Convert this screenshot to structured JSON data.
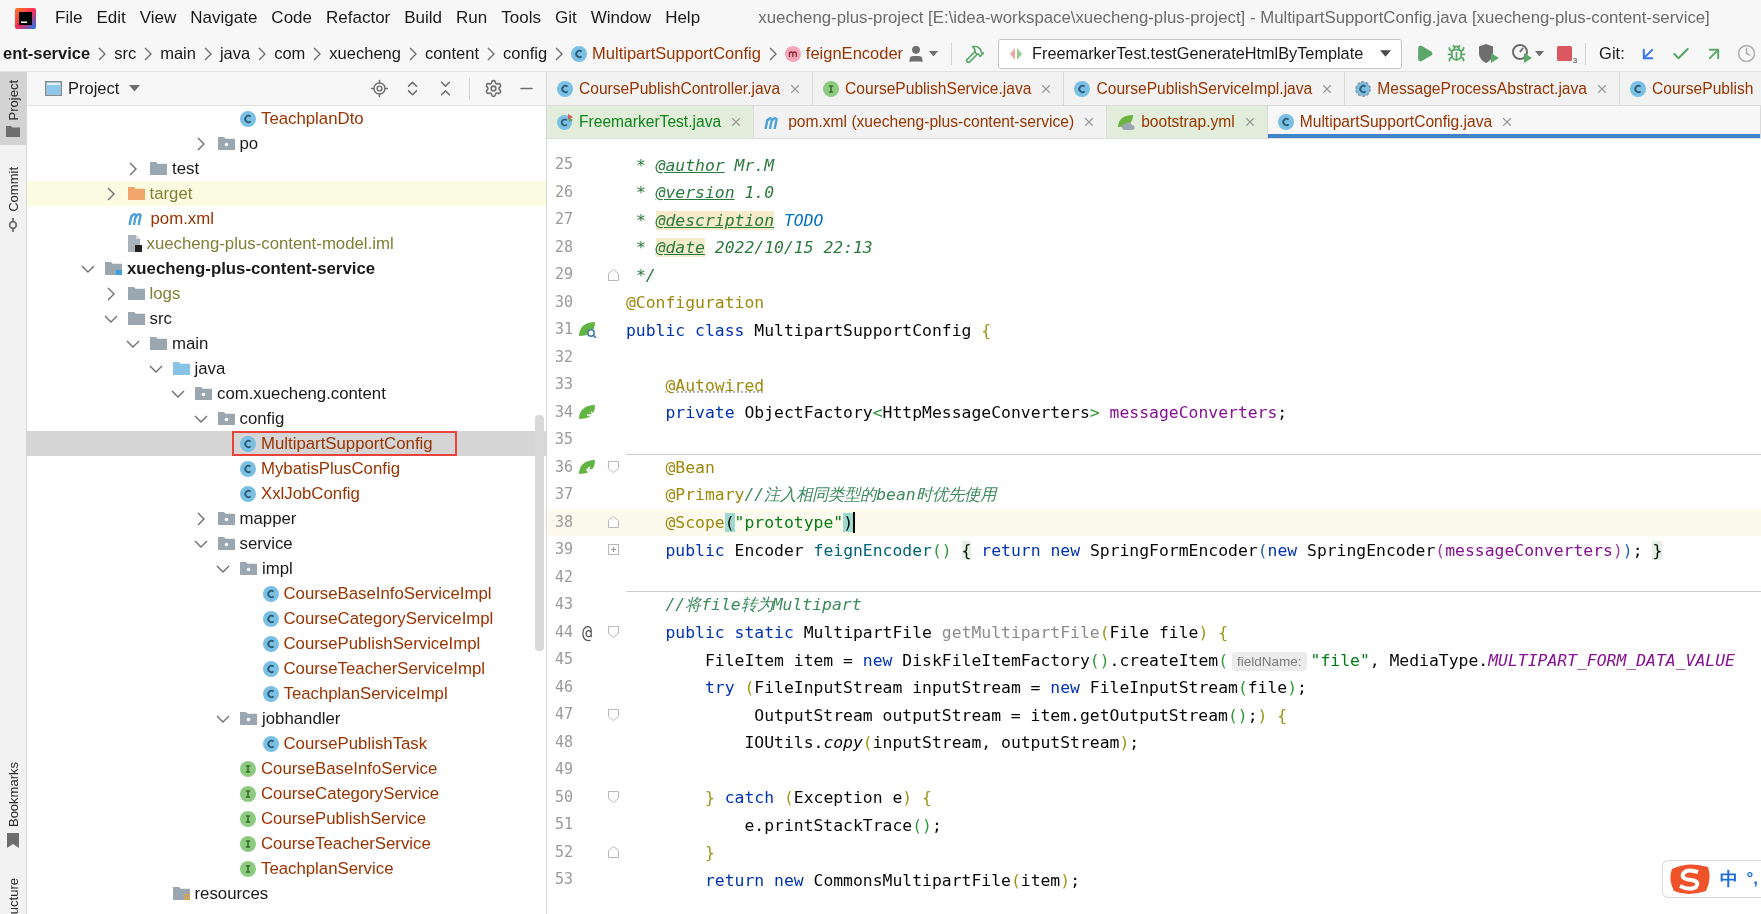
{
  "menu_bar": {
    "items": [
      "File",
      "Edit",
      "View",
      "Navigate",
      "Code",
      "Refactor",
      "Build",
      "Run",
      "Tools",
      "Git",
      "Window",
      "Help"
    ],
    "title": "xuecheng-plus-project [E:\\idea-workspace\\xuecheng-plus-project] - MultipartSupportConfig.java [xuecheng-plus-content-service]"
  },
  "breadcrumbs": [
    {
      "label": "ent-service",
      "kind": "module"
    },
    {
      "label": "src",
      "kind": "folder"
    },
    {
      "label": "main",
      "kind": "folder"
    },
    {
      "label": "java",
      "kind": "folder"
    },
    {
      "label": "com",
      "kind": "folder"
    },
    {
      "label": "xuecheng",
      "kind": "folder"
    },
    {
      "label": "content",
      "kind": "folder"
    },
    {
      "label": "config",
      "kind": "folder"
    },
    {
      "label": "MultipartSupportConfig",
      "kind": "class",
      "color": "#993300"
    },
    {
      "label": "feignEncoder",
      "kind": "method",
      "color": "#993300"
    }
  ],
  "toolbar": {
    "run_configuration": "FreemarkerTest.testGenerateHtmlByTemplate",
    "stop_badge": "3",
    "git_label": "Git:"
  },
  "tool_strip": {
    "top": [
      {
        "label": "Project",
        "kind": "project",
        "selected": true
      },
      {
        "label": "Commit",
        "kind": "commit",
        "selected": false
      }
    ],
    "bottom": [
      {
        "label": "Bookmarks",
        "kind": "bookmarks",
        "selected": false
      },
      {
        "label": "ucture",
        "kind": "structure",
        "selected": false
      }
    ]
  },
  "project_panel": {
    "title": "Project",
    "tree": [
      {
        "children": [
          {
            "children": [
              {
                "children": [
                  {
                    "children": [
                      {
                        "children": [
                          {
                            "children": [
                              {
                                "label": "TeachplanDto",
                                "kind": "class",
                                "color": "#993300",
                                "selected": false
                              }
                            ]
                          },
                          {
                            "label": "po",
                            "kind": "package",
                            "expanded": false,
                            "selected": false
                          }
                        ]
                      }
                    ]
                  }
                ]
              },
              {
                "label": "test",
                "kind": "folder",
                "expanded": false,
                "selected": false
              }
            ]
          },
          {
            "label": "target",
            "kind": "excluded",
            "expanded": false,
            "color": "#7f7f36",
            "selected": false
          },
          {
            "label": "pom.xml",
            "kind": "maven",
            "color": "#993300",
            "selected": false
          },
          {
            "label": "xuecheng-plus-content-model.iml",
            "kind": "iml",
            "color": "#7f7f36",
            "selected": false
          }
        ]
      },
      {
        "label": "xuecheng-plus-content-service",
        "kind": "module",
        "expanded": true,
        "selected": false,
        "children": [
          {
            "label": "logs",
            "kind": "folder",
            "expanded": false,
            "color": "#7f7f36",
            "selected": false
          },
          {
            "label": "src",
            "kind": "folder",
            "expanded": true,
            "selected": false,
            "children": [
              {
                "label": "main",
                "kind": "folder",
                "expanded": true,
                "selected": false,
                "children": [
                  {
                    "label": "java",
                    "kind": "source_root",
                    "expanded": true,
                    "selected": false,
                    "children": [
                      {
                        "label": "com.xuecheng.content",
                        "kind": "package",
                        "expanded": true,
                        "selected": false,
                        "children": [
                          {
                            "label": "config",
                            "kind": "package",
                            "expanded": true,
                            "selected": false,
                            "children": [
                              {
                                "label": "MultipartSupportConfig",
                                "kind": "class",
                                "color": "#993300",
                                "selected": true,
                                "outlined": true
                              },
                              {
                                "label": "MybatisPlusConfig",
                                "kind": "class",
                                "color": "#993300",
                                "selected": false
                              },
                              {
                                "label": "XxlJobConfig",
                                "kind": "class",
                                "color": "#993300",
                                "selected": false
                              }
                            ]
                          },
                          {
                            "label": "mapper",
                            "kind": "package",
                            "expanded": false,
                            "selected": false
                          },
                          {
                            "label": "service",
                            "kind": "package",
                            "expanded": true,
                            "selected": false,
                            "children": [
                              {
                                "label": "impl",
                                "kind": "package",
                                "expanded": true,
                                "selected": false,
                                "children": [
                                  {
                                    "label": "CourseBaseInfoServiceImpl",
                                    "kind": "class",
                                    "color": "#993300",
                                    "selected": false
                                  },
                                  {
                                    "label": "CourseCategoryServiceImpl",
                                    "kind": "class",
                                    "color": "#993300",
                                    "selected": false
                                  },
                                  {
                                    "label": "CoursePublishServiceImpl",
                                    "kind": "class",
                                    "color": "#993300",
                                    "selected": false
                                  },
                                  {
                                    "label": "CourseTeacherServiceImpl",
                                    "kind": "class",
                                    "color": "#993300",
                                    "selected": false
                                  },
                                  {
                                    "label": "TeachplanServiceImpl",
                                    "kind": "class",
                                    "color": "#993300",
                                    "selected": false
                                  }
                                ]
                              },
                              {
                                "label": "jobhandler",
                                "kind": "package",
                                "expanded": true,
                                "selected": false,
                                "children": [
                                  {
                                    "label": "CoursePublishTask",
                                    "kind": "class",
                                    "color": "#993300",
                                    "selected": false
                                  }
                                ]
                              },
                              {
                                "label": "CourseBaseInfoService",
                                "kind": "interface",
                                "color": "#993300",
                                "selected": false
                              },
                              {
                                "label": "CourseCategoryService",
                                "kind": "interface",
                                "color": "#993300",
                                "selected": false
                              },
                              {
                                "label": "CoursePublishService",
                                "kind": "interface",
                                "color": "#993300",
                                "selected": false
                              },
                              {
                                "label": "CourseTeacherService",
                                "kind": "interface",
                                "color": "#993300",
                                "selected": false
                              },
                              {
                                "label": "TeachplanService",
                                "kind": "interface",
                                "color": "#993300",
                                "selected": false
                              }
                            ]
                          }
                        ]
                      }
                    ]
                  },
                  {
                    "label": "resources",
                    "kind": "resource_root",
                    "selected": false
                  }
                ]
              }
            ]
          }
        ]
      }
    ]
  },
  "editor": {
    "tab_rows": [
      [
        {
          "label": "CoursePublishController.java",
          "kind": "class",
          "color": "#993300",
          "selected": false,
          "tinted": false,
          "closable": true
        },
        {
          "label": "CoursePublishService.java",
          "kind": "interface",
          "color": "#993300",
          "selected": false,
          "tinted": false,
          "closable": true
        },
        {
          "label": "CoursePublishServiceImpl.java",
          "kind": "class",
          "color": "#993300",
          "selected": false,
          "tinted": false,
          "closable": true
        },
        {
          "label": "MessageProcessAbstract.java",
          "kind": "abstract",
          "color": "#993300",
          "selected": false,
          "tinted": false,
          "closable": true
        },
        {
          "label": "CoursePublish",
          "kind": "class",
          "color": "#993300",
          "selected": false,
          "tinted": false,
          "closable": false
        }
      ],
      [
        {
          "label": "FreemarkerTest.java",
          "kind": "test",
          "color": "#10841a",
          "selected": false,
          "tinted": true,
          "closable": true
        },
        {
          "label": "pom.xml (xuecheng-plus-content-service)",
          "kind": "maven",
          "color": "#993300",
          "selected": false,
          "tinted": false,
          "closable": true
        },
        {
          "label": "bootstrap.yml",
          "kind": "yaml",
          "color": "#993300",
          "selected": false,
          "tinted": true,
          "closable": true
        },
        {
          "label": "MultipartSupportConfig.java",
          "kind": "class",
          "color": "#993300",
          "selected": true,
          "tinted": false,
          "closable": true
        }
      ]
    ],
    "lines": [
      {
        "number": "25",
        "current": false,
        "tokens": [
          {
            "text": " * ",
            "kind": "doc"
          },
          {
            "text": "@author",
            "kind": "doc_tag"
          },
          {
            "text": " Mr.M",
            "kind": "doc"
          }
        ]
      },
      {
        "number": "26",
        "current": false,
        "tokens": [
          {
            "text": " * ",
            "kind": "doc"
          },
          {
            "text": "@version",
            "kind": "doc_tag"
          },
          {
            "text": " 1.0",
            "kind": "doc"
          }
        ]
      },
      {
        "number": "27",
        "current": false,
        "tokens": [
          {
            "text": " * ",
            "kind": "doc"
          },
          {
            "text": "@description",
            "kind": "doc_tag_warn"
          },
          {
            "text": " TODO",
            "kind": "todo"
          }
        ]
      },
      {
        "number": "28",
        "current": false,
        "tokens": [
          {
            "text": " * ",
            "kind": "doc"
          },
          {
            "text": "@date",
            "kind": "doc_tag_warn"
          },
          {
            "text": " 2022/10/15 22:13",
            "kind": "doc"
          }
        ]
      },
      {
        "number": "29",
        "current": false,
        "fold_marker": {
          "kind": "close"
        },
        "tokens": [
          {
            "text": " */",
            "kind": "doc"
          }
        ]
      },
      {
        "number": "30",
        "current": false,
        "tokens": [
          {
            "text": "@Configuration",
            "kind": "ann"
          }
        ]
      },
      {
        "number": "31",
        "current": false,
        "gutter": {
          "kind": "bean_class"
        },
        "tokens": [
          {
            "text": "public class",
            "kind": "kw"
          },
          {
            "text": " MultipartSupportConfig ",
            "kind": "plain"
          },
          {
            "text": "{",
            "kind": "b1"
          }
        ]
      },
      {
        "number": "32",
        "current": false
      },
      {
        "number": "33",
        "current": false,
        "tokens": [
          {
            "text": "    @Autowired",
            "kind": "ann_weak"
          }
        ]
      },
      {
        "number": "34",
        "current": false,
        "gutter": {
          "kind": "bean_injected"
        },
        "tokens": [
          {
            "text": "    private",
            "kind": "kw"
          },
          {
            "text": " ObjectFactory",
            "kind": "plain"
          },
          {
            "text": "<",
            "kind": "b2"
          },
          {
            "text": "HttpMessageConverters",
            "kind": "plain"
          },
          {
            "text": ">",
            "kind": "b2"
          },
          {
            "text": " messageConverters",
            "kind": "field"
          },
          {
            "text": ";",
            "kind": "plain"
          }
        ]
      },
      {
        "number": "35",
        "current": false
      },
      {
        "number": "36",
        "current": false,
        "separator": true,
        "gutter": {
          "kind": "bean_method"
        },
        "fold_marker": {
          "kind": "open"
        },
        "tokens": [
          {
            "text": "    @Bean",
            "kind": "ann"
          }
        ]
      },
      {
        "number": "37",
        "current": false,
        "tokens": [
          {
            "text": "    @Primary",
            "kind": "ann"
          },
          {
            "text": "//注入相同类型的bean时优先使用",
            "kind": "comment"
          }
        ]
      },
      {
        "number": "38",
        "current": true,
        "fold_marker": {
          "kind": "close"
        },
        "tokens": [
          {
            "text": "    @Scope",
            "kind": "ann"
          },
          {
            "text": "(",
            "kind": "match"
          },
          {
            "text": "\"prototype\"",
            "kind": "str"
          },
          {
            "text": ")",
            "kind": "match"
          }
        ]
      },
      {
        "number": "39",
        "current": false,
        "fold_marker": {
          "kind": "collapsed"
        },
        "tokens": [
          {
            "text": "    public",
            "kind": "kw"
          },
          {
            "text": " Encoder ",
            "kind": "plain"
          },
          {
            "text": "feignEncoder",
            "kind": "method"
          },
          {
            "text": "()",
            "kind": "b2"
          },
          {
            "text": " {",
            "kind": "fold"
          },
          {
            "text": " return new",
            "kind": "kw"
          },
          {
            "text": " SpringFormEncoder",
            "kind": "plain"
          },
          {
            "text": "(",
            "kind": "b3"
          },
          {
            "text": "new",
            "kind": "kw"
          },
          {
            "text": " SpringEncoder",
            "kind": "plain"
          },
          {
            "text": "(",
            "kind": "b4"
          },
          {
            "text": "messageConverters",
            "kind": "field"
          },
          {
            "text": ")",
            "kind": "b4"
          },
          {
            "text": ")",
            "kind": "b3"
          },
          {
            "text": ";",
            "kind": "plain"
          },
          {
            "text": " }",
            "kind": "fold"
          }
        ]
      },
      {
        "number": "42",
        "current": false
      },
      {
        "number": "43",
        "current": false,
        "separator": true,
        "tokens": [
          {
            "text": "    //将file转为Multipart",
            "kind": "comment"
          }
        ]
      },
      {
        "number": "44",
        "current": false,
        "gutter": {
          "kind": "text",
          "text": "@"
        },
        "fold_marker": {
          "kind": "open"
        },
        "tokens": [
          {
            "text": "    public static",
            "kind": "kw"
          },
          {
            "text": " MultipartFile ",
            "kind": "plain"
          },
          {
            "text": "getMultipartFile",
            "kind": "unused_method"
          },
          {
            "text": "(",
            "kind": "b1"
          },
          {
            "text": "File file",
            "kind": "plain"
          },
          {
            "text": ")",
            "kind": "b1"
          },
          {
            "text": " {",
            "kind": "b1"
          }
        ]
      },
      {
        "number": "45",
        "current": false,
        "tokens": [
          {
            "text": "        FileItem item = ",
            "kind": "plain"
          },
          {
            "text": "new",
            "kind": "kw"
          },
          {
            "text": " DiskFileItemFactory",
            "kind": "plain"
          },
          {
            "text": "()",
            "kind": "b2"
          },
          {
            "text": ".createItem",
            "kind": "plain"
          },
          {
            "text": "(",
            "kind": "b2"
          },
          {
            "text": "fieldName:",
            "kind": "hint"
          },
          {
            "text": "\"file\"",
            "kind": "str"
          },
          {
            "text": ", MediaType.",
            "kind": "plain"
          },
          {
            "text": "MULTIPART_FORM_DATA_VALUE",
            "kind": "static_field"
          }
        ]
      },
      {
        "number": "46",
        "current": false,
        "tokens": [
          {
            "text": "        try",
            "kind": "kw"
          },
          {
            "text": " (",
            "kind": "b1"
          },
          {
            "text": "FileInputStream inputStream = ",
            "kind": "plain"
          },
          {
            "text": "new",
            "kind": "kw"
          },
          {
            "text": " FileInputStream",
            "kind": "plain"
          },
          {
            "text": "(",
            "kind": "b2"
          },
          {
            "text": "file",
            "kind": "plain"
          },
          {
            "text": ")",
            "kind": "b2"
          },
          {
            "text": ";",
            "kind": "plain"
          }
        ]
      },
      {
        "number": "47",
        "current": false,
        "fold_marker": {
          "kind": "open"
        },
        "tokens": [
          {
            "text": "             OutputStream outputStream = item.getOutputStream",
            "kind": "plain"
          },
          {
            "text": "()",
            "kind": "b2"
          },
          {
            "text": ";",
            "kind": "plain"
          },
          {
            "text": ")",
            "kind": "b1"
          },
          {
            "text": " {",
            "kind": "b1"
          }
        ]
      },
      {
        "number": "48",
        "current": false,
        "tokens": [
          {
            "text": "            IOUtils.",
            "kind": "plain"
          },
          {
            "text": "copy",
            "kind": "static_method"
          },
          {
            "text": "(",
            "kind": "b1"
          },
          {
            "text": "inputStream, outputStream",
            "kind": "plain"
          },
          {
            "text": ")",
            "kind": "b1"
          },
          {
            "text": ";",
            "kind": "plain"
          }
        ]
      },
      {
        "number": "49",
        "current": false
      },
      {
        "number": "50",
        "current": false,
        "fold_marker": {
          "kind": "open"
        },
        "tokens": [
          {
            "text": "        }",
            "kind": "b1"
          },
          {
            "text": " catch",
            "kind": "kw"
          },
          {
            "text": " (",
            "kind": "b1"
          },
          {
            "text": "Exception e",
            "kind": "plain"
          },
          {
            "text": ")",
            "kind": "b1"
          },
          {
            "text": " {",
            "kind": "b1"
          }
        ]
      },
      {
        "number": "51",
        "current": false,
        "tokens": [
          {
            "text": "            e.printStackTrace",
            "kind": "plain"
          },
          {
            "text": "()",
            "kind": "b2"
          },
          {
            "text": ";",
            "kind": "plain"
          }
        ]
      },
      {
        "number": "52",
        "current": false,
        "fold_marker": {
          "kind": "close"
        },
        "tokens": [
          {
            "text": "        }",
            "kind": "b1"
          }
        ]
      },
      {
        "number": "53",
        "current": false,
        "tokens": [
          {
            "text": "        return new",
            "kind": "kw"
          },
          {
            "text": " CommonsMultipartFile",
            "kind": "plain"
          },
          {
            "text": "(",
            "kind": "b1"
          },
          {
            "text": "item",
            "kind": "plain"
          },
          {
            "text": ")",
            "kind": "b1"
          },
          {
            "text": ";",
            "kind": "plain"
          }
        ]
      }
    ]
  },
  "ime_bar": {
    "mode": "中",
    "punctuation": "°,"
  }
}
